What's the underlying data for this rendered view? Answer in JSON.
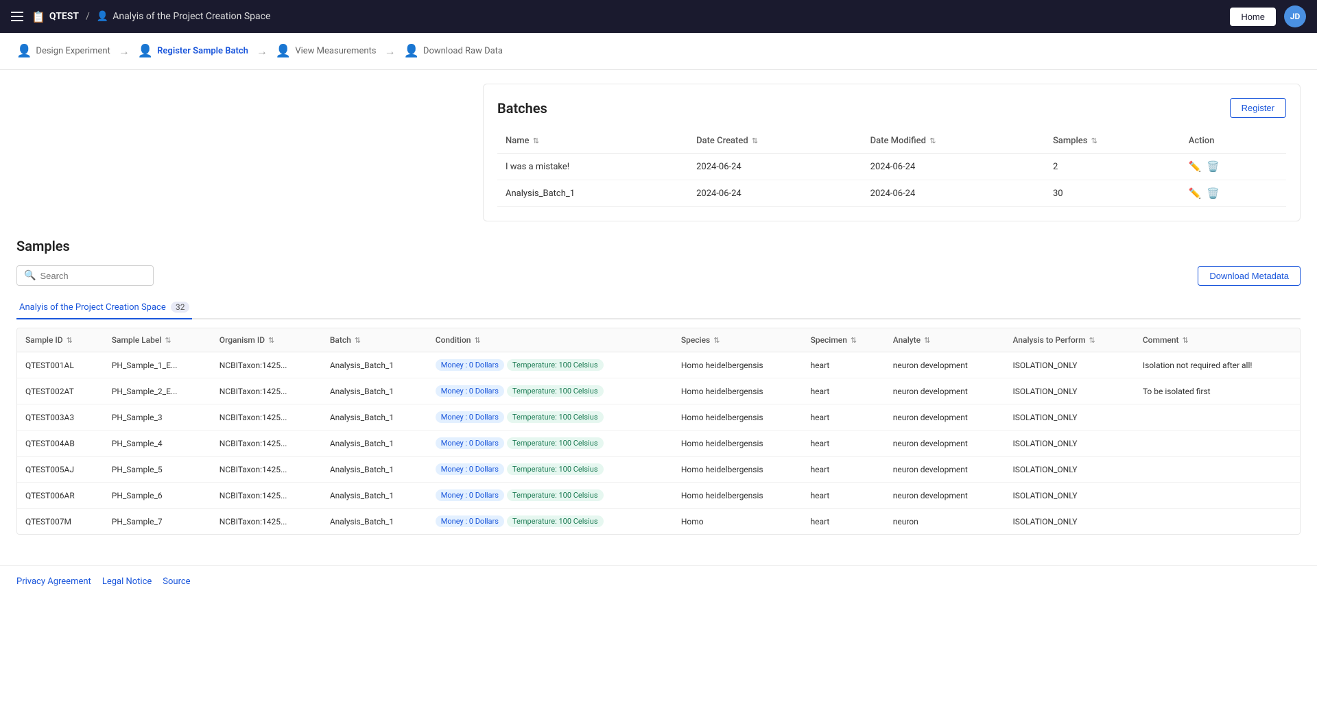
{
  "navbar": {
    "menu_icon_label": "Menu",
    "project_icon": "📋",
    "breadcrumb_project": "QTEST",
    "breadcrumb_separator": "/",
    "breadcrumb_page": "Analyis of the Project Creation Space",
    "home_label": "Home",
    "avatar_initials": "JD"
  },
  "workflow": {
    "steps": [
      {
        "id": "design",
        "label": "Design Experiment",
        "icon": "👤",
        "active": false
      },
      {
        "id": "register",
        "label": "Register Sample Batch",
        "icon": "👤",
        "active": true
      },
      {
        "id": "view",
        "label": "View Measurements",
        "icon": "👤",
        "active": false
      },
      {
        "id": "download",
        "label": "Download Raw Data",
        "icon": "👤",
        "active": false
      }
    ]
  },
  "batches": {
    "title": "Batches",
    "register_label": "Register",
    "columns": [
      {
        "label": "Name"
      },
      {
        "label": "Date Created"
      },
      {
        "label": "Date Modified"
      },
      {
        "label": "Samples"
      },
      {
        "label": "Action"
      }
    ],
    "rows": [
      {
        "name": "I was a mistake!",
        "date_created": "2024-06-24",
        "date_modified": "2024-06-24",
        "samples": "2"
      },
      {
        "name": "Analysis_Batch_1",
        "date_created": "2024-06-24",
        "date_modified": "2024-06-24",
        "samples": "30"
      }
    ]
  },
  "samples": {
    "title": "Samples",
    "search_placeholder": "Search",
    "download_metadata_label": "Download Metadata",
    "tab_label": "Analyis of the Project Creation Space",
    "tab_count": "32",
    "columns": [
      {
        "label": "Sample ID"
      },
      {
        "label": "Sample Label"
      },
      {
        "label": "Organism ID"
      },
      {
        "label": "Batch"
      },
      {
        "label": "Condition"
      },
      {
        "label": "Species"
      },
      {
        "label": "Specimen"
      },
      {
        "label": "Analyte"
      },
      {
        "label": "Analysis to Perform"
      },
      {
        "label": "Comment"
      }
    ],
    "rows": [
      {
        "sample_id": "QTEST001AL",
        "sample_label": "PH_Sample_1_E...",
        "organism_id": "NCBITaxon:1425...",
        "batch": "Analysis_Batch_1",
        "conditions": [
          {
            "label": "Money : 0 Dollars",
            "type": "blue"
          },
          {
            "label": "Temperature: 100 Celsius",
            "type": "green"
          }
        ],
        "species": "Homo heidelbergensis",
        "specimen": "heart",
        "analyte": "neuron development",
        "analysis": "ISOLATION_ONLY",
        "comment": "Isolation not required after all!"
      },
      {
        "sample_id": "QTEST002AT",
        "sample_label": "PH_Sample_2_E...",
        "organism_id": "NCBITaxon:1425...",
        "batch": "Analysis_Batch_1",
        "conditions": [
          {
            "label": "Money : 0 Dollars",
            "type": "blue"
          },
          {
            "label": "Temperature: 100 Celsius",
            "type": "green"
          }
        ],
        "species": "Homo heidelbergensis",
        "specimen": "heart",
        "analyte": "neuron development",
        "analysis": "ISOLATION_ONLY",
        "comment": "To be isolated first"
      },
      {
        "sample_id": "QTEST003A3",
        "sample_label": "PH_Sample_3",
        "organism_id": "NCBITaxon:1425...",
        "batch": "Analysis_Batch_1",
        "conditions": [
          {
            "label": "Money : 0 Dollars",
            "type": "blue"
          },
          {
            "label": "Temperature: 100 Celsius",
            "type": "green"
          }
        ],
        "species": "Homo heidelbergensis",
        "specimen": "heart",
        "analyte": "neuron development",
        "analysis": "ISOLATION_ONLY",
        "comment": ""
      },
      {
        "sample_id": "QTEST004AB",
        "sample_label": "PH_Sample_4",
        "organism_id": "NCBITaxon:1425...",
        "batch": "Analysis_Batch_1",
        "conditions": [
          {
            "label": "Money : 0 Dollars",
            "type": "blue"
          },
          {
            "label": "Temperature: 100 Celsius",
            "type": "green"
          }
        ],
        "species": "Homo heidelbergensis",
        "specimen": "heart",
        "analyte": "neuron development",
        "analysis": "ISOLATION_ONLY",
        "comment": ""
      },
      {
        "sample_id": "QTEST005AJ",
        "sample_label": "PH_Sample_5",
        "organism_id": "NCBITaxon:1425...",
        "batch": "Analysis_Batch_1",
        "conditions": [
          {
            "label": "Money : 0 Dollars",
            "type": "blue"
          },
          {
            "label": "Temperature: 100 Celsius",
            "type": "green"
          }
        ],
        "species": "Homo heidelbergensis",
        "specimen": "heart",
        "analyte": "neuron development",
        "analysis": "ISOLATION_ONLY",
        "comment": ""
      },
      {
        "sample_id": "QTEST006AR",
        "sample_label": "PH_Sample_6",
        "organism_id": "NCBITaxon:1425...",
        "batch": "Analysis_Batch_1",
        "conditions": [
          {
            "label": "Money : 0 Dollars",
            "type": "blue"
          },
          {
            "label": "Temperature: 100 Celsius",
            "type": "green"
          }
        ],
        "species": "Homo heidelbergensis",
        "specimen": "heart",
        "analyte": "neuron development",
        "analysis": "ISOLATION_ONLY",
        "comment": ""
      },
      {
        "sample_id": "QTEST007M",
        "sample_label": "PH_Sample_7",
        "organism_id": "NCBITaxon:1425...",
        "batch": "Analysis_Batch_1",
        "conditions": [
          {
            "label": "Money : 0 Dollars",
            "type": "blue"
          },
          {
            "label": "Temperature: 100 Celsius",
            "type": "green"
          }
        ],
        "species": "Homo",
        "specimen": "heart",
        "analyte": "neuron",
        "analysis": "ISOLATION_ONLY",
        "comment": ""
      }
    ]
  },
  "footer": {
    "privacy_label": "Privacy Agreement",
    "legal_label": "Legal Notice",
    "source_label": "Source"
  }
}
